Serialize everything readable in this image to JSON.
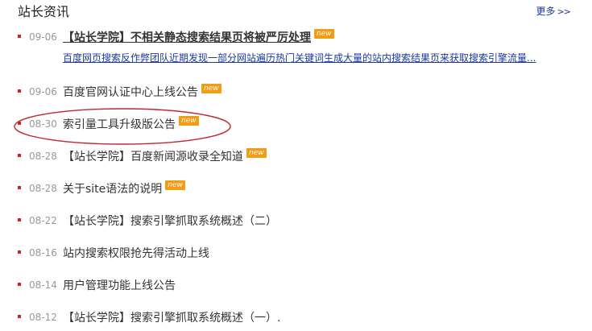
{
  "header": {
    "title": "站长资讯",
    "more_label": "更多",
    "more_arrows": ">>"
  },
  "news": {
    "items": [
      {
        "date": "09-06",
        "title": "【站长学院】不相关静态搜索结果页将被严厉处理",
        "badge": "new",
        "summary": "百度网页搜索反作弊团队近期发现一部分网站遍历热门关键词生成大量的站内搜索结果页来获取搜索引擎流量..."
      },
      {
        "date": "09-06",
        "title": "百度官网认证中心上线公告",
        "badge": "new"
      },
      {
        "date": "08-30",
        "title": "索引量工具升级版公告",
        "badge": "new"
      },
      {
        "date": "08-28",
        "title": "【站长学院】百度新闻源收录全知道",
        "badge": "new"
      },
      {
        "date": "08-28",
        "title": "关于site语法的说明",
        "badge": "new"
      },
      {
        "date": "08-22",
        "title": "【站长学院】搜索引擎抓取系统概述（二）"
      },
      {
        "date": "08-16",
        "title": "站内搜索权限抢先得活动上线"
      },
      {
        "date": "08-14",
        "title": "用户管理功能上线公告"
      },
      {
        "date": "08-12",
        "title": "【站长学院】搜索引擎抓取系统概述（一）."
      }
    ]
  },
  "colors": {
    "bullet": "#c0282d",
    "badge": "#f29b14",
    "link": "#1a3a9a",
    "annotation": "#c0282d"
  }
}
